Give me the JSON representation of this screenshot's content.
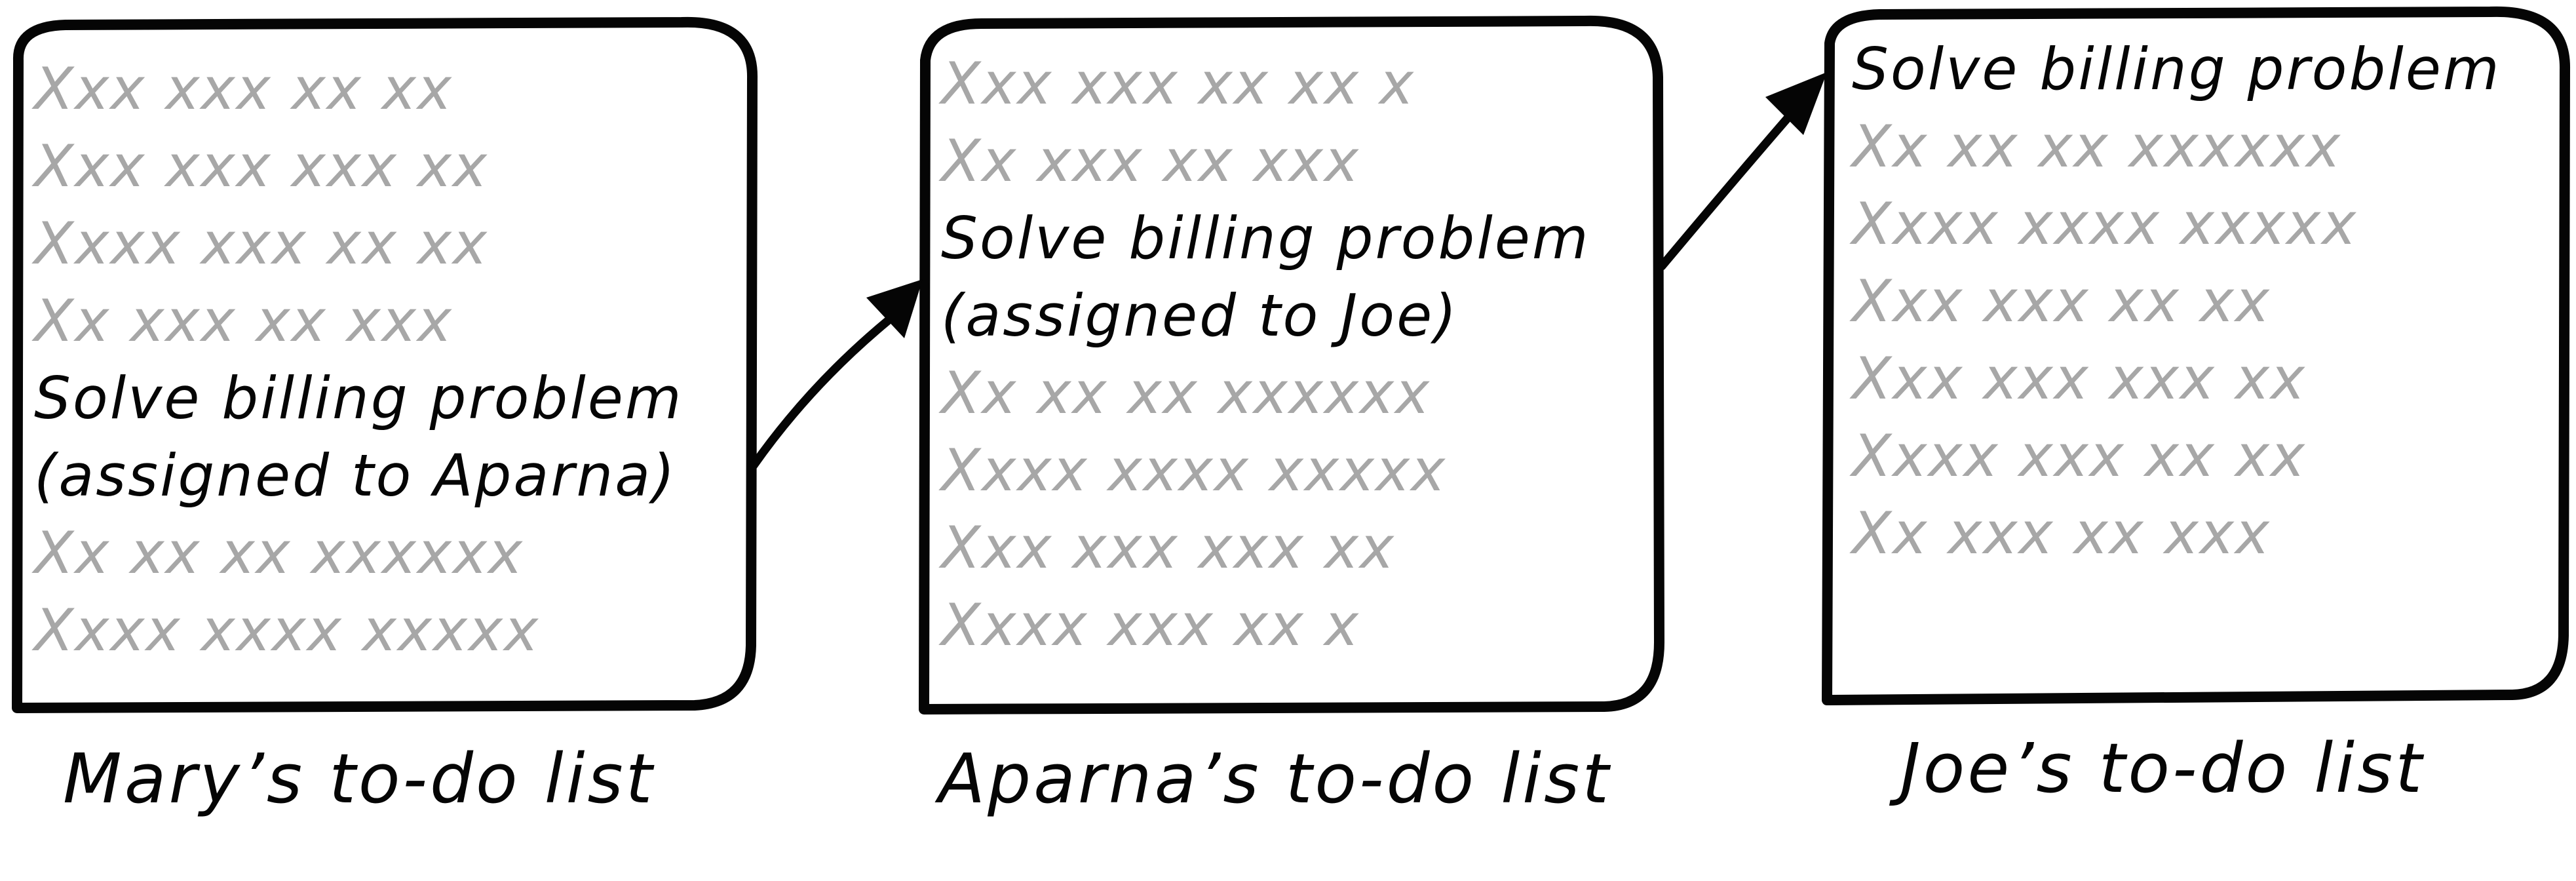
{
  "colors": {
    "ink": "#050505",
    "filler": "#a7a7a7",
    "background": "#ffffff"
  },
  "lists": [
    {
      "name": "mary",
      "caption": "Mary’s to-do list",
      "lines": [
        {
          "text": "Xxx xxx xx xx",
          "is_task": false
        },
        {
          "text": "Xxx xxx xxx xx",
          "is_task": false
        },
        {
          "text": "Xxxx xxx xx xx",
          "is_task": false
        },
        {
          "text": "Xx xxx xx xxx",
          "is_task": false
        },
        {
          "text": "Solve billing problem",
          "is_task": true
        },
        {
          "text": "(assigned to Aparna)",
          "is_task": true
        },
        {
          "text": "Xx xx xx xxxxxx",
          "is_task": false
        },
        {
          "text": "Xxxx xxxx  xxxxx",
          "is_task": false
        }
      ]
    },
    {
      "name": "aparna",
      "caption": "Aparna’s to-do list",
      "lines": [
        {
          "text": "Xxx xxx xx xx  x",
          "is_task": false
        },
        {
          "text": "Xx xxx xx xxx",
          "is_task": false
        },
        {
          "text": "Solve billing problem",
          "is_task": true
        },
        {
          "text": "(assigned to Joe)",
          "is_task": true
        },
        {
          "text": "Xx xx xx xxxxxx",
          "is_task": false
        },
        {
          "text": "Xxxx xxxx  xxxxx",
          "is_task": false
        },
        {
          "text": "Xxx xxx xxx xx",
          "is_task": false
        },
        {
          "text": "Xxxx xxx xx x",
          "is_task": false
        }
      ]
    },
    {
      "name": "joe",
      "caption": "Joe’s to-do list",
      "lines": [
        {
          "text": "Solve billing problem",
          "is_task": true
        },
        {
          "text": "Xx xx xx xxxxxx",
          "is_task": false
        },
        {
          "text": "Xxxx xxxx  xxxxx",
          "is_task": false
        },
        {
          "text": "Xxx xxx xx xx",
          "is_task": false
        },
        {
          "text": "Xxx xxx xxx xx",
          "is_task": false
        },
        {
          "text": "Xxxx xxx xx xx",
          "is_task": false
        },
        {
          "text": "Xx xxx xx xxx",
          "is_task": false
        }
      ]
    }
  ],
  "arrows": [
    {
      "name": "mary-to-aparna",
      "from": "mary",
      "to": "aparna"
    },
    {
      "name": "aparna-to-joe",
      "from": "aparna",
      "to": "joe"
    }
  ]
}
